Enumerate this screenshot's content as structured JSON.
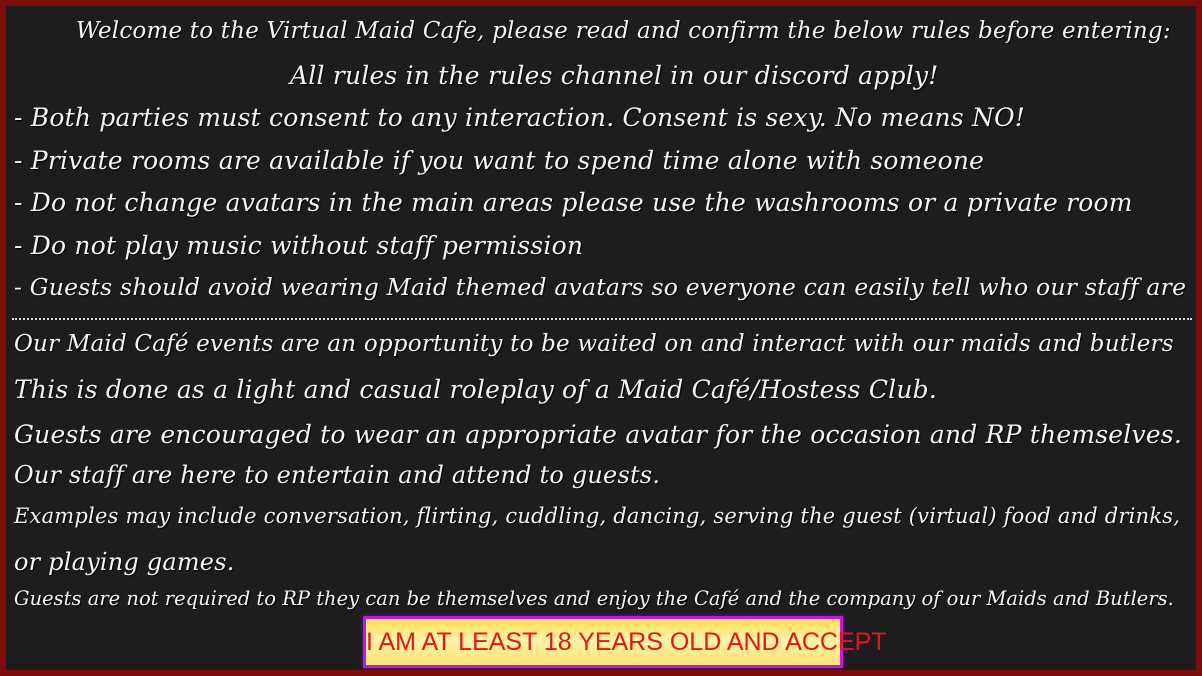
{
  "header": {
    "welcome": "Welcome to the Virtual Maid Cafe, please read and confirm the below rules before entering:",
    "discord_note": "All rules in the rules channel in our discord apply!"
  },
  "rules": [
    "- Both parties must consent to any interaction. Consent is sexy. No means NO!",
    "- Private rooms are available if you want to spend time alone with someone",
    "- Do not change avatars in the main areas please use the washrooms or a private room",
    "- Do not play music without staff permission",
    "- Guests should avoid wearing Maid themed avatars so everyone can easily tell who our staff are"
  ],
  "info": [
    "Our Maid Café events are an opportunity to be waited on and interact with our maids and butlers",
    "This is done as a light and casual roleplay of a Maid Café/Hostess Club.",
    "Guests are encouraged to wear an appropriate avatar for the occasion and RP themselves.",
    "Our staff are here to entertain and attend to guests.",
    "Examples may include conversation, flirting, cuddling, dancing, serving the guest (virtual) food and drinks,",
    "or playing games.",
    "Guests are not required to RP they can be themselves and enjoy the Café and the company of our Maids and Butlers."
  ],
  "accept_button": {
    "label": "I AM AT LEAST 18 YEARS OLD AND ACCEPT"
  },
  "colors": {
    "frame": "#7d0c0c",
    "background": "#1d1d1d",
    "text": "#f4f4f4",
    "button_text": "#e4161c",
    "button_fill": "#ffdc57",
    "button_border": "#c21bd6"
  }
}
